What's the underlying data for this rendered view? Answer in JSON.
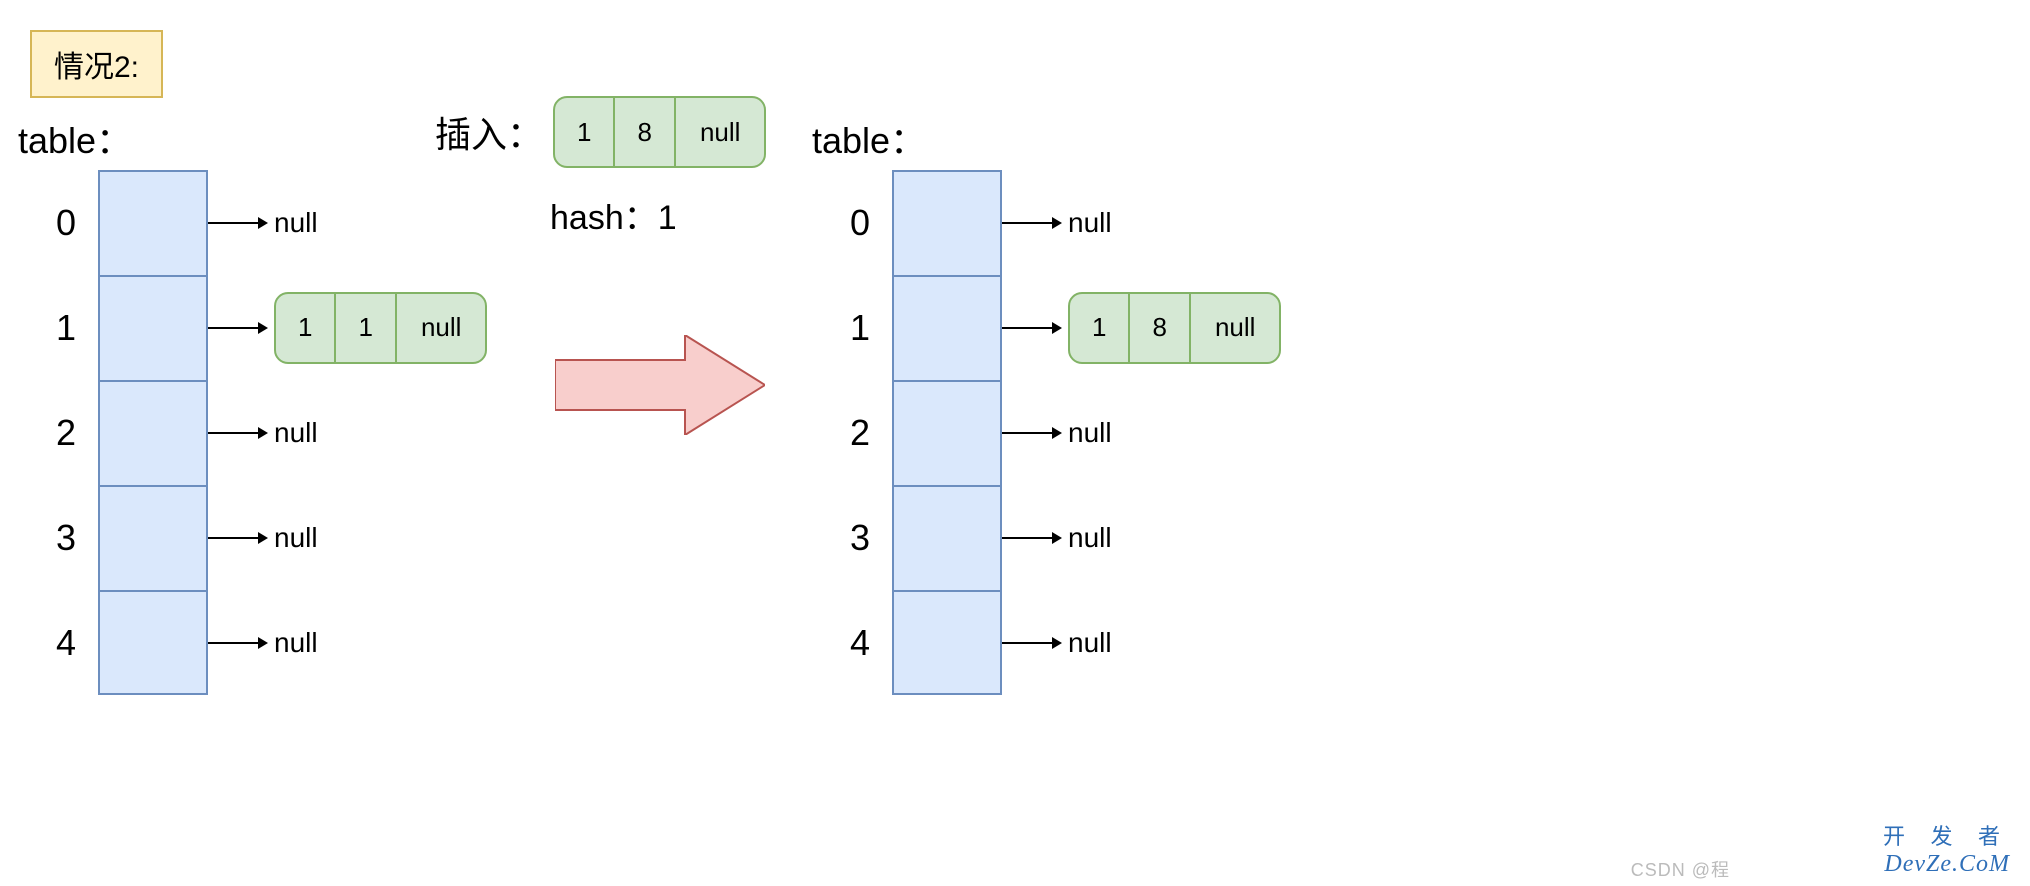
{
  "caseLabel": "情况2:",
  "left": {
    "title": "table：",
    "indices": [
      "0",
      "1",
      "2",
      "3",
      "4"
    ],
    "pointers": [
      "null",
      null,
      "null",
      "null",
      "null"
    ],
    "node": {
      "k": "1",
      "v": "1",
      "next": "null"
    }
  },
  "insert": {
    "label": "插入：",
    "node": {
      "k": "1",
      "v": "8",
      "next": "null"
    },
    "hash": "hash：1"
  },
  "right": {
    "title": "table：",
    "indices": [
      "0",
      "1",
      "2",
      "3",
      "4"
    ],
    "pointers": [
      "null",
      null,
      "null",
      "null",
      "null"
    ],
    "node": {
      "k": "1",
      "v": "8",
      "next": "null"
    }
  },
  "watermark": {
    "line1": "开 发 者",
    "line2": "DevZe.CoM",
    "csdn": "CSDN @程"
  }
}
